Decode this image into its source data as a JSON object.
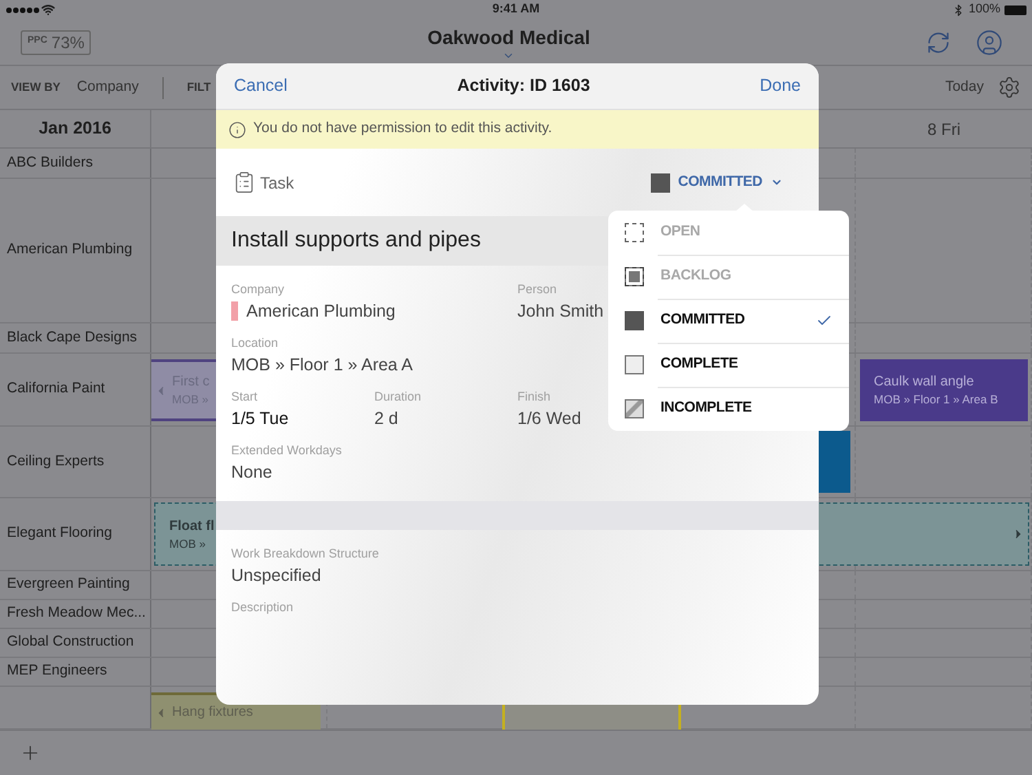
{
  "status_bar": {
    "time": "9:41 AM",
    "battery": "100%"
  },
  "header": {
    "ppc_label": "PPC",
    "ppc_value": "73%",
    "title": "Oakwood Medical"
  },
  "toolbar": {
    "view_by_label": "VIEW BY",
    "view_by_value": "Company",
    "filter_label": "FILT",
    "today": "Today"
  },
  "calendar": {
    "month": "Jan 2016",
    "day_header": "8 Fri",
    "rows": [
      {
        "company": "ABC Builders"
      },
      {
        "company": "American Plumbing"
      },
      {
        "company": "Black Cape Designs"
      },
      {
        "company": "California Paint",
        "bars": [
          {
            "kind": "light-purple",
            "title": "First c",
            "subtitle": "MOB »",
            "continues_left": true
          },
          {
            "kind": "purple",
            "title": "Caulk wall angle",
            "subtitle": "MOB » Floor 1 » Area B",
            "continues_left": false
          }
        ]
      },
      {
        "company": "Ceiling Experts",
        "bars": [
          {
            "kind": "blue"
          }
        ]
      },
      {
        "company": "Elegant Flooring",
        "bars": [
          {
            "kind": "dashed-teal",
            "title": "Float fl",
            "subtitle": "MOB »",
            "continues_right": true
          }
        ]
      },
      {
        "company": "Evergreen Painting"
      },
      {
        "company": "Fresh Meadow Mec..."
      },
      {
        "company": "Global Construction"
      },
      {
        "company": "MEP Engineers"
      },
      {
        "bars": [
          {
            "kind": "olive",
            "title": "Hang fixtures",
            "continues_left": true
          },
          {
            "kind": "yellow-outline"
          }
        ]
      }
    ]
  },
  "modal": {
    "cancel": "Cancel",
    "title": "Activity: ID 1603",
    "done": "Done",
    "notice": "You do not have permission to edit this activity.",
    "type_label": "Task",
    "status": {
      "label": "COMMITTED",
      "kind": "committed"
    },
    "activity_name": "Install supports and pipes",
    "fields": [
      {
        "label": "Company",
        "value": "American Plumbing",
        "color": "#f2a0a8"
      },
      {
        "label": "Person",
        "value": "John Smith"
      },
      {
        "label": "Location",
        "value": "MOB » Floor 1 » Area A"
      },
      {
        "label": "Start",
        "value": "1/5 Tue"
      },
      {
        "label": "Duration",
        "value": "2 d"
      },
      {
        "label": "Finish",
        "value": "1/6 Wed"
      },
      {
        "label": "Extended Workdays",
        "value": "None"
      },
      {
        "label": "Work Breakdown Structure",
        "value": "Unspecified"
      },
      {
        "label": "Description"
      }
    ]
  },
  "status_menu": {
    "items": [
      {
        "label": "OPEN",
        "kind": "open",
        "disabled": true,
        "selected": false
      },
      {
        "label": "BACKLOG",
        "kind": "backlog",
        "disabled": true,
        "selected": false
      },
      {
        "label": "COMMITTED",
        "kind": "committed",
        "disabled": false,
        "selected": true
      },
      {
        "label": "COMPLETE",
        "kind": "complete",
        "disabled": false,
        "selected": false
      },
      {
        "label": "INCOMPLETE",
        "kind": "incomplete",
        "disabled": false,
        "selected": false
      }
    ]
  }
}
